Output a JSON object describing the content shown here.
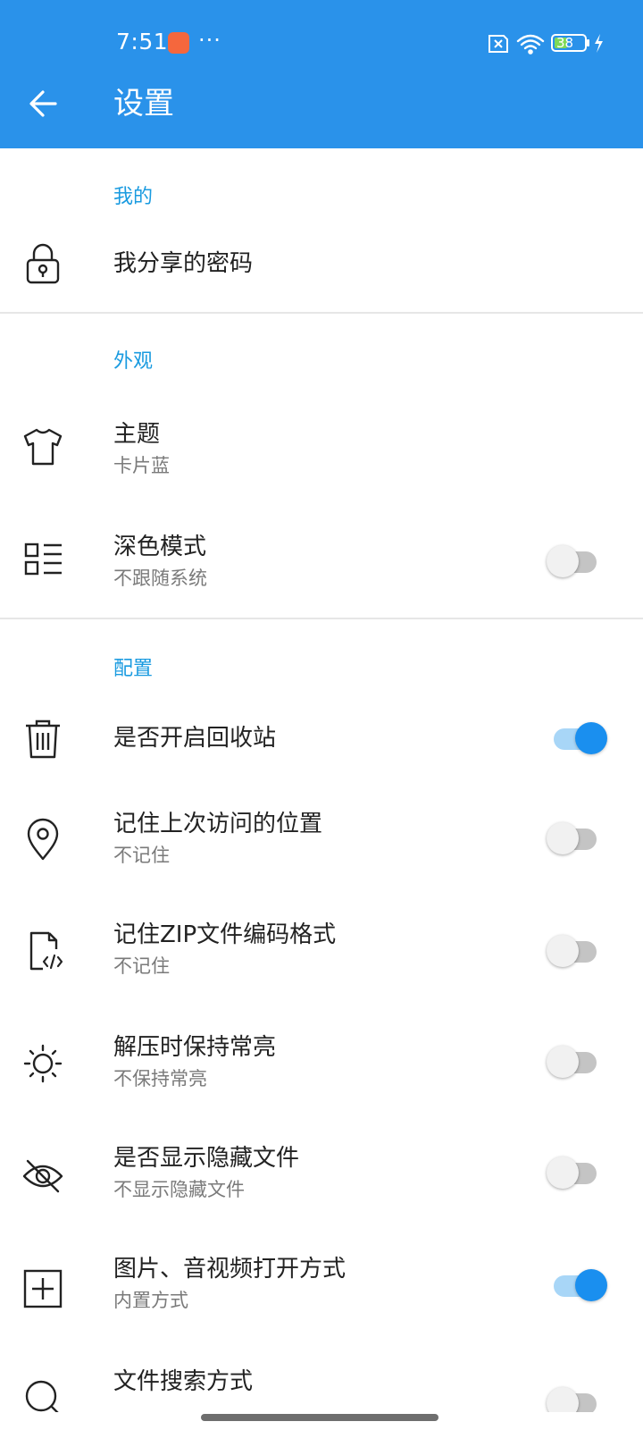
{
  "status_bar": {
    "time": "7:51",
    "more": "···",
    "battery": "38",
    "icons": [
      "app-notification-icon",
      "sim-off-icon",
      "wifi-icon",
      "battery-icon",
      "charging-icon"
    ]
  },
  "app_bar": {
    "back_icon": "arrow-left-icon",
    "title": "设置",
    "color": "#2a92ea"
  },
  "accent_color": "#1a9be0",
  "sections": [
    {
      "header": "我的",
      "items": [
        {
          "icon": "lock-icon",
          "title": "我分享的密码",
          "subtitle": ""
        }
      ]
    },
    {
      "header": "外观",
      "items": [
        {
          "icon": "tshirt-icon",
          "title": "主题",
          "subtitle": "卡片蓝"
        },
        {
          "icon": "list-icon",
          "title": "深色模式",
          "subtitle": "不跟随系统",
          "toggle": false
        }
      ]
    },
    {
      "header": "配置",
      "items": [
        {
          "icon": "trash-icon",
          "title": "是否开启回收站",
          "subtitle": "",
          "toggle": true
        },
        {
          "icon": "location-pin-icon",
          "title": "记住上次访问的位置",
          "subtitle": "不记住",
          "toggle": false
        },
        {
          "icon": "code-file-icon",
          "title": "记住ZIP文件编码格式",
          "subtitle": "不记住",
          "toggle": false
        },
        {
          "icon": "sun-icon",
          "title": "解压时保持常亮",
          "subtitle": "不保持常亮",
          "toggle": false
        },
        {
          "icon": "eye-off-icon",
          "title": "是否显示隐藏文件",
          "subtitle": "不显示隐藏文件",
          "toggle": false
        },
        {
          "icon": "plus-box-icon",
          "title": "图片、音视频打开方式",
          "subtitle": "内置方式",
          "toggle": true
        },
        {
          "icon": "search-icon",
          "title": "文件搜索方式",
          "subtitle": "",
          "toggle": false
        }
      ]
    }
  ]
}
